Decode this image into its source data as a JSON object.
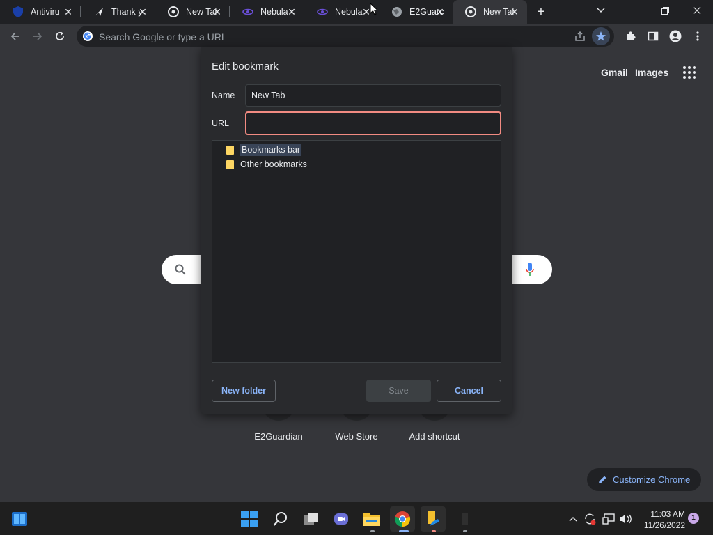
{
  "tabs": [
    {
      "title": "Antiviru",
      "icon": "antivirus-icon",
      "active": false
    },
    {
      "title": "Thank y",
      "icon": "send-icon",
      "active": false
    },
    {
      "title": "New Tal",
      "icon": "chrome-icon",
      "active": false
    },
    {
      "title": "Nebula",
      "icon": "nebula-icon",
      "active": false
    },
    {
      "title": "Nebula",
      "icon": "nebula-icon",
      "active": false
    },
    {
      "title": "E2Guarc",
      "icon": "globe-icon",
      "active": false
    },
    {
      "title": "New Tal",
      "icon": "chrome-icon",
      "active": true
    }
  ],
  "omnibox": {
    "placeholder": "Search Google or type a URL"
  },
  "ntp": {
    "gmail": "Gmail",
    "images": "Images",
    "shortcuts": [
      "E2Guardian",
      "Web Store",
      "Add shortcut"
    ],
    "customize": "Customize Chrome"
  },
  "dialog": {
    "title": "Edit bookmark",
    "name_label": "Name",
    "name_value": "New Tab",
    "url_label": "URL",
    "url_value": "",
    "folders": [
      "Bookmarks bar",
      "Other bookmarks"
    ],
    "selected_folder": "Bookmarks bar",
    "new_folder": "New folder",
    "save": "Save",
    "cancel": "Cancel"
  },
  "taskbar": {
    "time": "11:03 AM",
    "date": "11/26/2022",
    "notifications": "1"
  },
  "colors": {
    "accent": "#8ab4f8",
    "focus_border": "#f28b82",
    "folder": "#fdd663",
    "bookmark_star": "#8ab4f8"
  }
}
